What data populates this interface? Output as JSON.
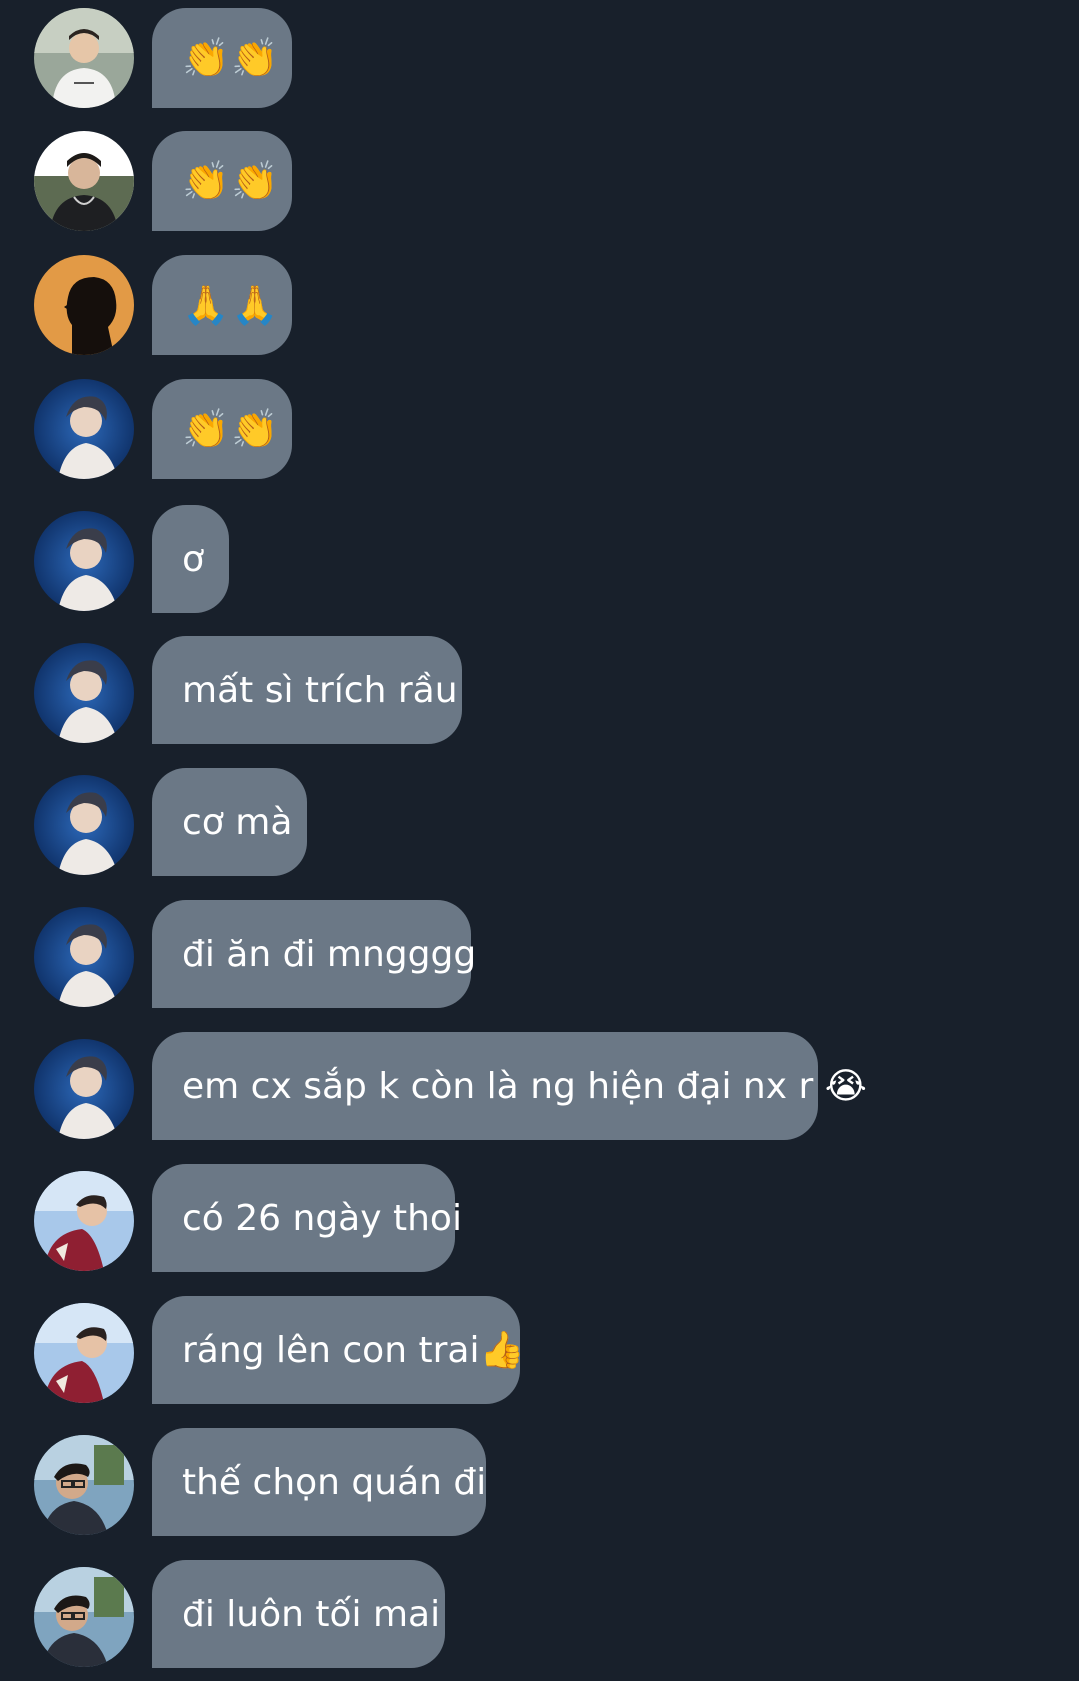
{
  "messages": [
    {
      "avatar": "avatar-white-shirt",
      "text": "👏👏"
    },
    {
      "avatar": "avatar-necklace",
      "text": "👏👏"
    },
    {
      "avatar": "avatar-silhouette-orange",
      "text": "🙏🙏"
    },
    {
      "avatar": "avatar-blue-stage",
      "text": "👏👏"
    },
    {
      "avatar": "avatar-blue-stage",
      "text": "ơ"
    },
    {
      "avatar": "avatar-blue-stage",
      "text": "mất sì trích rầu"
    },
    {
      "avatar": "avatar-blue-stage",
      "text": "cơ mà"
    },
    {
      "avatar": "avatar-blue-stage",
      "text": "đi ăn đi mngggg"
    },
    {
      "avatar": "avatar-blue-stage",
      "text": "em cx sắp k còn là ng hiện đại nx r 😭"
    },
    {
      "avatar": "avatar-red-jacket",
      "text": "có 26 ngày thoi"
    },
    {
      "avatar": "avatar-red-jacket",
      "text": "ráng lên con trai👍"
    },
    {
      "avatar": "avatar-glasses-outdoor",
      "text": "thế chọn quán đi"
    },
    {
      "avatar": "avatar-glasses-outdoor",
      "text": "đi luôn tối mai"
    }
  ],
  "colors": {
    "background": "#18202b",
    "bubble": "#6b7886",
    "text": "#ffffff"
  }
}
